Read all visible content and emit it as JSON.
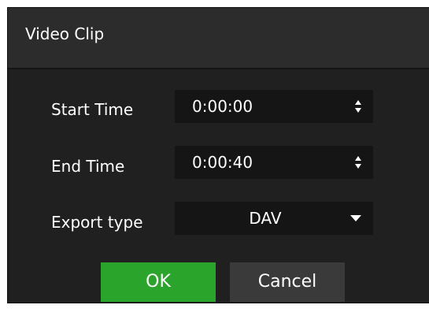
{
  "dialog": {
    "title": "Video Clip"
  },
  "start_time": {
    "label": "Start Time",
    "value": "0:00:00",
    "icon": "spinner-arrows-icon"
  },
  "end_time": {
    "label": "End Time",
    "value": "0:00:40",
    "icon": "spinner-arrows-icon"
  },
  "export_type": {
    "label": "Export type",
    "selected": "DAV",
    "icon": "dropdown-caret-icon"
  },
  "buttons": {
    "ok_label": "OK",
    "cancel_label": "Cancel"
  },
  "colors": {
    "ok_button": "#2aa42a",
    "dialog_bg": "#202020",
    "field_bg": "#151515"
  }
}
